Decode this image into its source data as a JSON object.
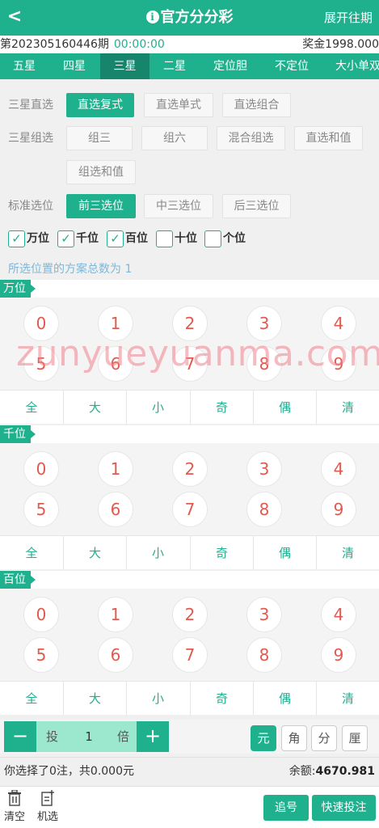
{
  "header": {
    "back_label": "<",
    "title": "官方分分彩",
    "history_label": "展开往期",
    "info_icon": "info-icon"
  },
  "issue": {
    "text": "第202305160446期",
    "countdown": "00:00:00",
    "bonus": "奖金1998.000"
  },
  "tabs": [
    {
      "label": "五星",
      "active": false
    },
    {
      "label": "四星",
      "active": false
    },
    {
      "label": "三星",
      "active": true
    },
    {
      "label": "二星",
      "active": false
    },
    {
      "label": "定位胆",
      "active": false
    },
    {
      "label": "不定位",
      "active": false
    },
    {
      "label": "大小单双",
      "active": false
    }
  ],
  "methods": {
    "direct": {
      "label": "三星直选",
      "options": [
        {
          "label": "直选复式",
          "selected": true
        },
        {
          "label": "直选单式",
          "selected": false
        },
        {
          "label": "直选组合",
          "selected": false
        }
      ]
    },
    "group": {
      "label": "三星组选",
      "options": [
        {
          "label": "组三",
          "selected": false
        },
        {
          "label": "组六",
          "selected": false
        },
        {
          "label": "混合组选",
          "selected": false
        },
        {
          "label": "直选和值",
          "selected": false
        },
        {
          "label": "组选和值",
          "selected": false
        }
      ]
    },
    "standard": {
      "label": "标准选位",
      "options": [
        {
          "label": "前三选位",
          "selected": true
        },
        {
          "label": "中三选位",
          "selected": false
        },
        {
          "label": "后三选位",
          "selected": false
        }
      ]
    }
  },
  "positions": [
    {
      "label": "万位",
      "checked": true
    },
    {
      "label": "千位",
      "checked": true
    },
    {
      "label": "百位",
      "checked": true
    },
    {
      "label": "十位",
      "checked": false
    },
    {
      "label": "个位",
      "checked": false
    }
  ],
  "plan_count_text": "所选位置的方案总数为 1",
  "digit_blocks": [
    {
      "title": "万位",
      "numbers": [
        "0",
        "1",
        "2",
        "3",
        "4",
        "5",
        "6",
        "7",
        "8",
        "9"
      ]
    },
    {
      "title": "千位",
      "numbers": [
        "0",
        "1",
        "2",
        "3",
        "4",
        "5",
        "6",
        "7",
        "8",
        "9"
      ]
    },
    {
      "title": "百位",
      "numbers": [
        "0",
        "1",
        "2",
        "3",
        "4",
        "5",
        "6",
        "7",
        "8",
        "9"
      ]
    }
  ],
  "quick_ops": [
    "全",
    "大",
    "小",
    "奇",
    "偶",
    "清"
  ],
  "multiplier": {
    "minus": "−",
    "plus": "+",
    "label_before": "投",
    "value": "1",
    "label_after": "倍"
  },
  "units": [
    {
      "label": "元",
      "selected": true
    },
    {
      "label": "角",
      "selected": false
    },
    {
      "label": "分",
      "selected": false
    },
    {
      "label": "厘",
      "selected": false
    }
  ],
  "summary": {
    "selection_text": "你选择了0注，共0.000元",
    "balance_label": "余额:",
    "balance_value": "4670.981"
  },
  "footer": {
    "clear_label": "清空",
    "random_label": "机选",
    "chase_label": "追号",
    "quick_bet_label": "快速投注"
  },
  "watermark": "zunyueyuanma.com",
  "colors": {
    "primary": "#1fb08e",
    "primary_dark": "#17856c",
    "number": "#e05a4f",
    "stepper_bg": "#9ce8cf",
    "hint": "#7bb8dc"
  }
}
